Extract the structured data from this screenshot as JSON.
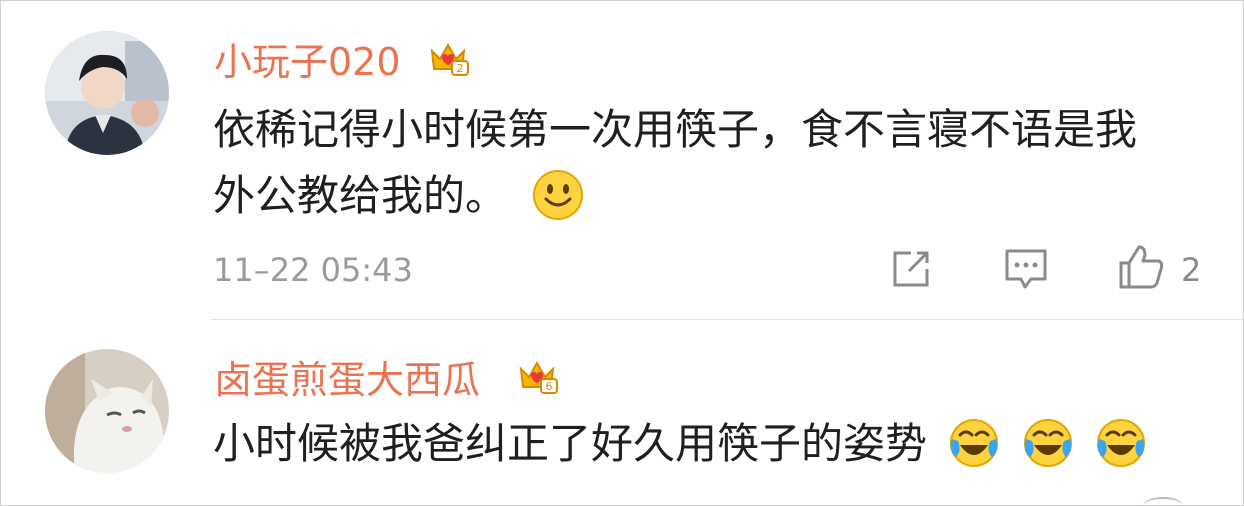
{
  "comments": [
    {
      "username": "小玩子020",
      "badge_icon": "crown-vip-badge-icon",
      "text_line1": "依稀记得小时候第一次用筷子，食不言寝不语是我",
      "text_line2": "外公教给我的。",
      "emoji": "smile-emoji-icon",
      "timestamp": "11–22 05:43",
      "like_count": "2",
      "actions": [
        "share-icon",
        "comment-icon",
        "like-icon"
      ]
    },
    {
      "username": "卤蛋煎蛋大西瓜",
      "badge_icon": "crown-vip-badge-icon",
      "text": "小时候被我爸纠正了好久用筷子的姿势",
      "emojis": [
        "laugh-cry-emoji-icon",
        "laugh-cry-emoji-icon",
        "laugh-cry-emoji-icon"
      ]
    }
  ],
  "colors": {
    "username": "#eb7350",
    "text": "#1f1f1f",
    "meta": "#9a9a9a",
    "divider": "#e2e2e2"
  }
}
